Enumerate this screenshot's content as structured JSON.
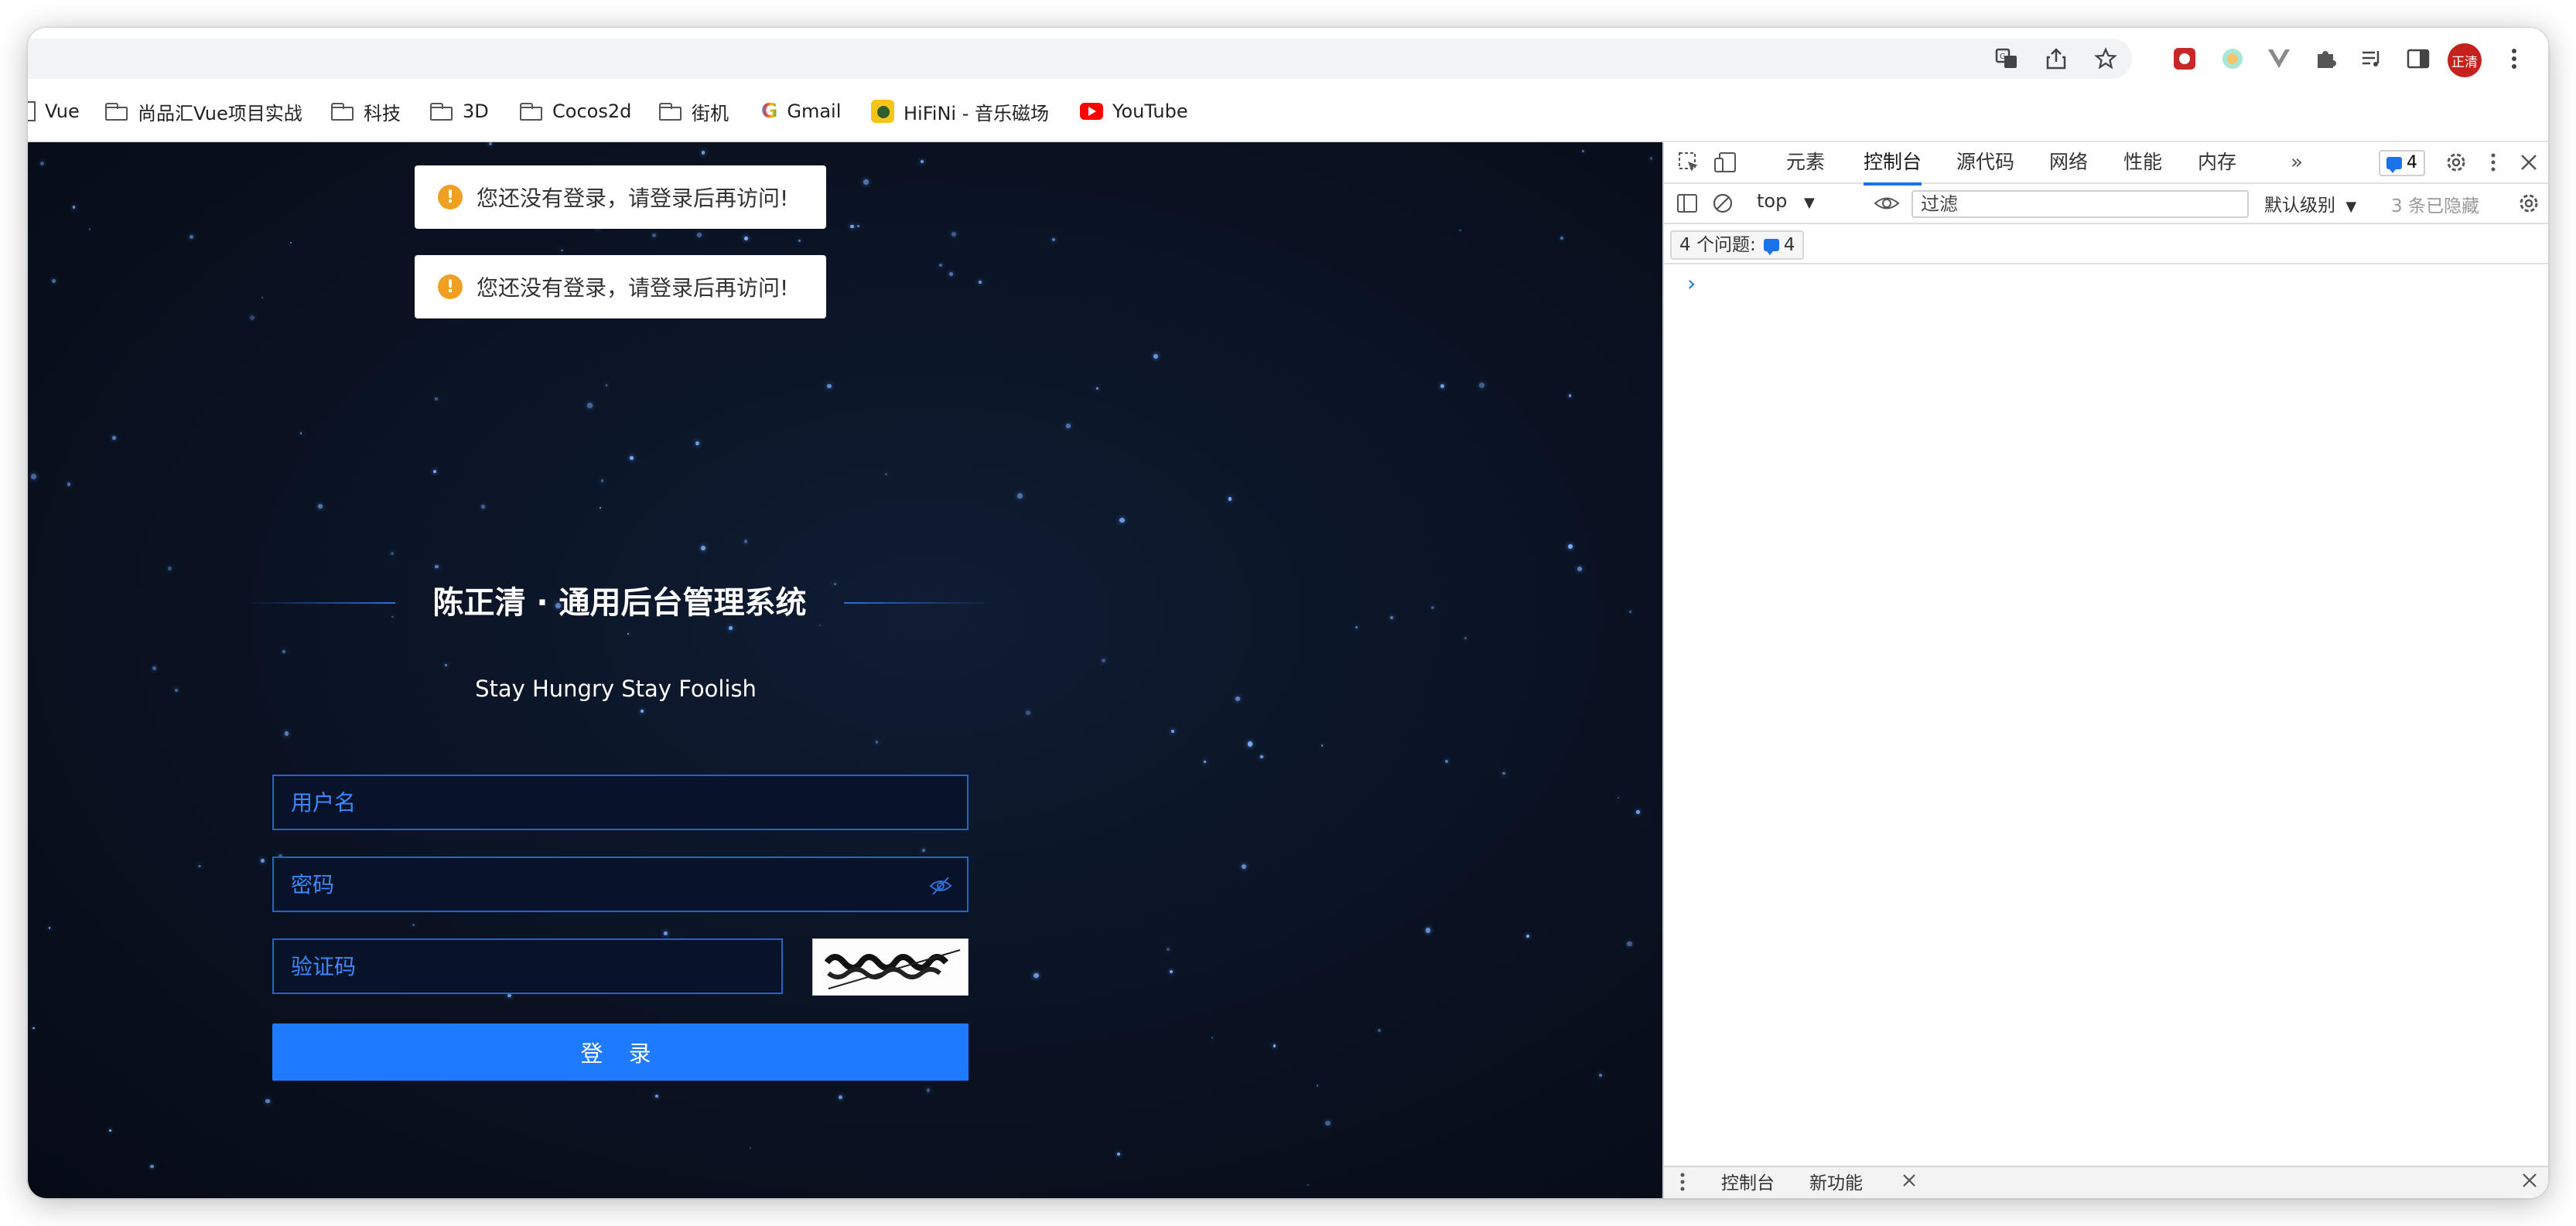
{
  "browser": {
    "profile_avatar": "正清",
    "omnibox_icons": [
      "translate-icon",
      "share-icon",
      "bookmark-star-icon"
    ],
    "toolbar_icons": [
      "extension-1-icon",
      "extension-2-icon",
      "vue-devtools-icon",
      "extensions-puzzle-icon",
      "reading-list-icon",
      "side-panel-icon",
      "menu-icon"
    ]
  },
  "bookmarks": [
    {
      "label": "Vue",
      "icon": "page-icon"
    },
    {
      "label": "尚品汇Vue项目实战",
      "icon": "folder-icon"
    },
    {
      "label": "科技",
      "icon": "folder-icon"
    },
    {
      "label": "3D",
      "icon": "folder-icon"
    },
    {
      "label": "Cocos2d",
      "icon": "folder-icon"
    },
    {
      "label": "街机",
      "icon": "folder-icon"
    },
    {
      "label": "Gmail",
      "icon": "google-icon"
    },
    {
      "label": "HiFiNi - 音乐磁场",
      "icon": "hifini-icon"
    },
    {
      "label": "YouTube",
      "icon": "youtube-icon"
    }
  ],
  "page": {
    "toasts": [
      "您还没有登录，请登录后再访问!",
      "您还没有登录，请登录后再访问!"
    ],
    "title": "陈正清 · 通用后台管理系统",
    "subtitle": "Stay Hungry Stay Foolish",
    "username_placeholder": "用户名",
    "password_placeholder": "密码",
    "captcha_placeholder": "验证码",
    "login_label": "登 录",
    "accent": "#1e7bff"
  },
  "devtools": {
    "tabs": [
      "元素",
      "控制台",
      "源代码",
      "网络",
      "性能",
      "内存"
    ],
    "active_tab": "控制台",
    "issues_badge": "4",
    "context": "top",
    "filter_placeholder": "过滤",
    "level": "默认级别",
    "hidden": "3 条已隐藏",
    "issues_label": "4 个问题:",
    "issues_count": "4",
    "prompt": "›",
    "drawer_tabs": [
      "控制台",
      "新功能"
    ]
  }
}
